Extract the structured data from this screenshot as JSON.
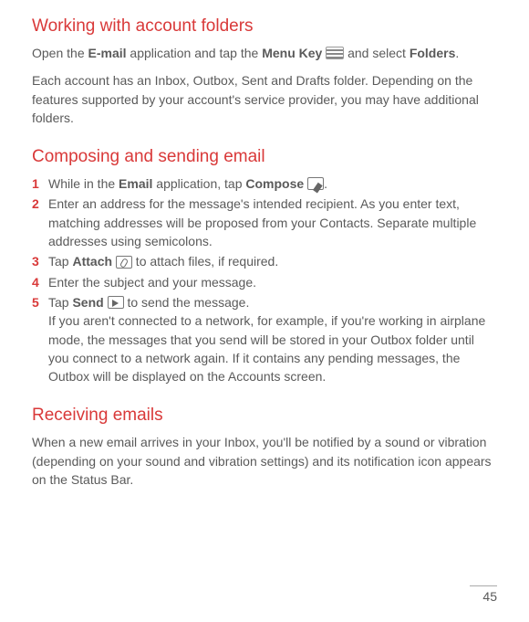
{
  "section1": {
    "title": "Working with account folders",
    "p1_a": "Open the ",
    "p1_b": "E-mail",
    "p1_c": " application and tap the ",
    "p1_d": "Menu Key",
    "p1_e": " and select ",
    "p1_f": "Folders",
    "p1_g": ".",
    "p2": "Each account has an Inbox, Outbox, Sent and Drafts folder. Depending on the features supported by your account's service provider, you may have additional folders."
  },
  "section2": {
    "title": "Composing and sending email",
    "items": [
      {
        "a": "While in the ",
        "b": "Email",
        "c": " application, tap ",
        "d": "Compose",
        "e": "."
      },
      {
        "text": "Enter an address for the message's intended recipient. As you enter text, matching addresses will be proposed from your Contacts. Separate multiple addresses using semicolons."
      },
      {
        "a": "Tap ",
        "b": "Attach",
        "c": " to attach files, if required."
      },
      {
        "text": "Enter the subject and your message."
      },
      {
        "a": "Tap ",
        "b": "Send",
        "c": " to send the message.",
        "rest": "If you aren't connected to a network, for example, if you're working in airplane mode, the messages that you send will be stored in your Outbox folder until you connect to a network again. If it contains any pending messages, the Outbox will be displayed on the Accounts screen."
      }
    ]
  },
  "section3": {
    "title": "Receiving emails",
    "p1": "When a new email arrives in your Inbox, you'll be notified by a sound or vibration (depending on your sound and vibration settings) and its notification icon appears on the Status Bar."
  },
  "pageNumber": "45"
}
